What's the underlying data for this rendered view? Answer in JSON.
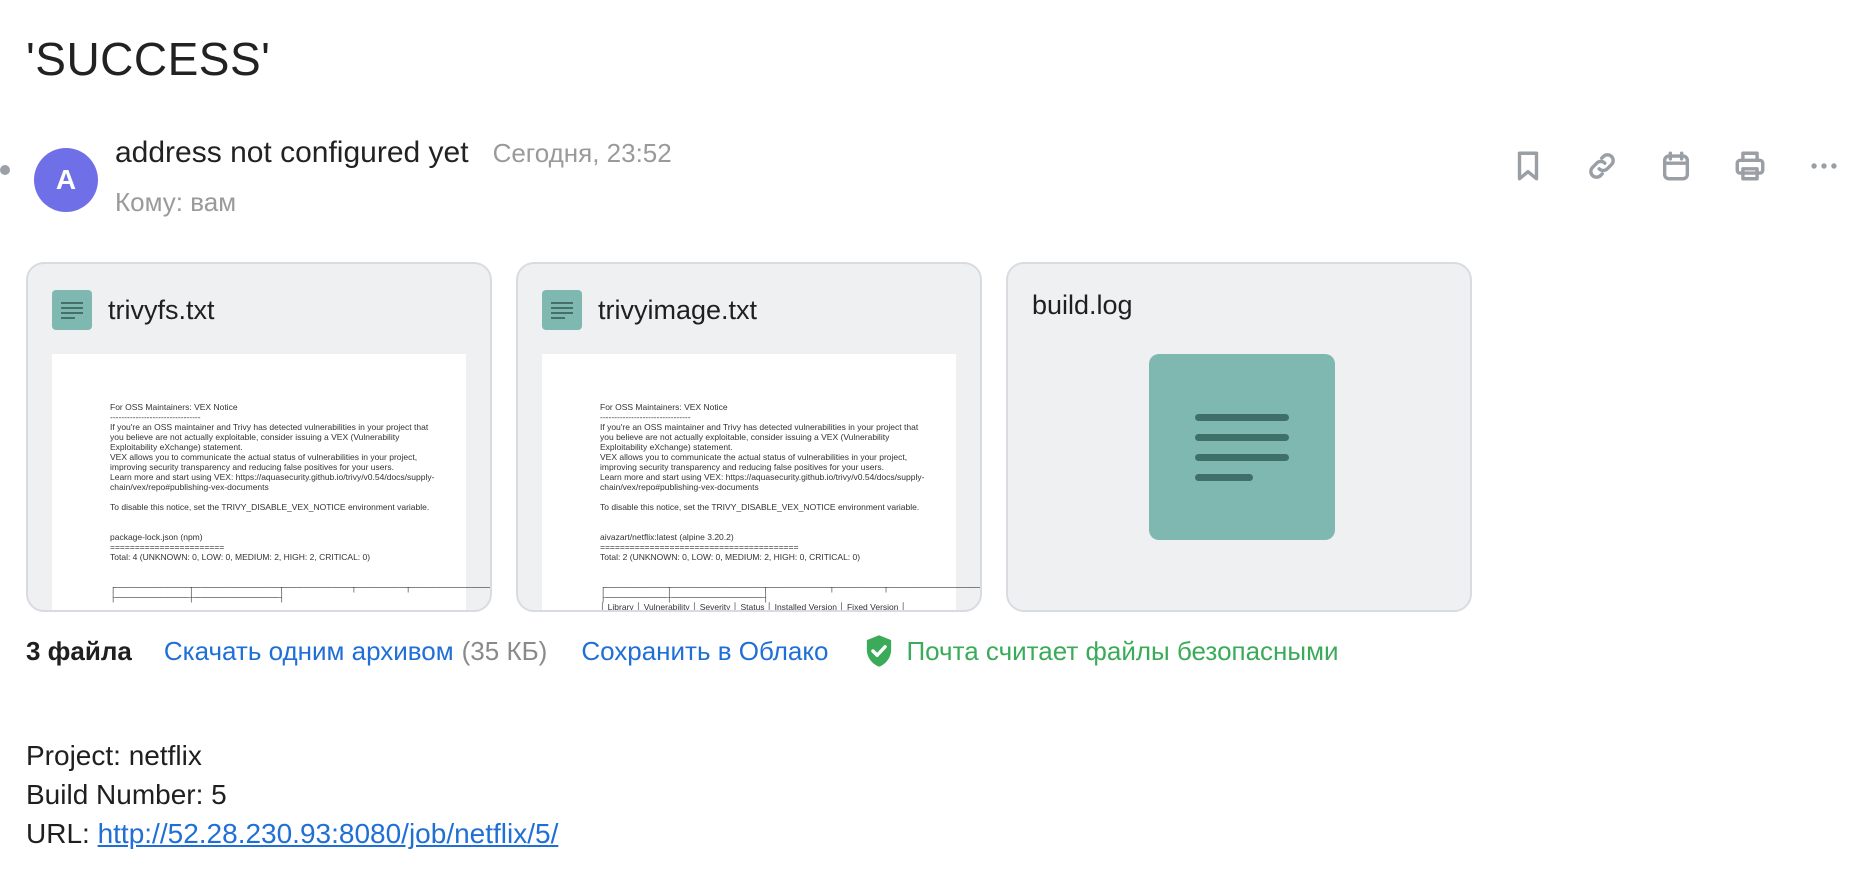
{
  "subject": "'SUCCESS'",
  "sender": {
    "avatar_letter": "A",
    "name": "address not configured yet",
    "date": "Сегодня, 23:52",
    "recipient": "Кому: вам"
  },
  "actions": [
    {
      "icon": "bookmark-icon"
    },
    {
      "icon": "link-icon"
    },
    {
      "icon": "calendar-icon"
    },
    {
      "icon": "print-icon"
    },
    {
      "icon": "more-icon"
    }
  ],
  "attachments": [
    {
      "name": "trivyfs.txt",
      "preview_text": "For OSS Maintainers: VEX Notice\n--------------------------------\nIf you're an OSS maintainer and Trivy has detected vulnerabilities in your project that\nyou believe are not actually exploitable, consider issuing a VEX (Vulnerability\nExploitability eXchange) statement.\nVEX allows you to communicate the actual status of vulnerabilities in your project,\nimproving security transparency and reducing false positives for your users.\nLearn more and start using VEX: https://aquasecurity.github.io/trivy/v0.54/docs/supply-\nchain/vex/repo#publishing-vex-documents\n\nTo disable this notice, set the TRIVY_DISABLE_VEX_NOTICE environment variable.\n\n\npackage-lock.json (npm)\n=======================\nTotal: 4 (UNKNOWN: 0, LOW: 0, MEDIUM: 2, HIGH: 2, CRITICAL: 0)\n\n\n┌────────────┬──────────────┬───────────┬────────┬───────────────────┬──────────┐\n├────────────┼──────────────┤\n\n│ Library │ Vulnerability │ Severity │ Status │ Installed Version │ Fixed"
    },
    {
      "name": "trivyimage.txt",
      "preview_text": "For OSS Maintainers: VEX Notice\n--------------------------------\nIf you're an OSS maintainer and Trivy has detected vulnerabilities in your project that\nyou believe are not actually exploitable, consider issuing a VEX (Vulnerability\nExploitability eXchange) statement.\nVEX allows you to communicate the actual status of vulnerabilities in your project,\nimproving security transparency and reducing false positives for your users.\nLearn more and start using VEX: https://aquasecurity.github.io/trivy/v0.54/docs/supply-\nchain/vex/repo#publishing-vex-documents\n\nTo disable this notice, set the TRIVY_DISABLE_VEX_NOTICE environment variable.\n\n\naivazart/netflix:latest (alpine 3.20.2)\n========================================\nTotal: 2 (UNKNOWN: 0, LOW: 0, MEDIUM: 2, HIGH: 0, CRITICAL: 0)\n\n\n┌──────────┬───────────────┬──────────┬────────┬───────────────────┬───────────────┐\n├──────────┼───────────────┤\n│ Library │ Vulnerability │ Severity │ Status │ Installed Version │ Fixed Version │\nTitle"
    },
    {
      "name": "build.log",
      "preview_text": ""
    }
  ],
  "footer": {
    "count": "3 файла",
    "download": "Скачать одним архивом",
    "size": "(35 КБ)",
    "save": "Сохранить в Облако",
    "safe": "Почта считает файлы безопасными"
  },
  "body": {
    "project": "Project: netflix",
    "build": "Build Number: 5",
    "url_label": "URL: ",
    "url": "http://52.28.230.93:8080/job/netflix/5/"
  },
  "colors": {
    "avatar": "#6f6fe8",
    "file_icon": "#7fb8b0",
    "link": "#1f6fd6",
    "safe": "#3bab5a"
  }
}
